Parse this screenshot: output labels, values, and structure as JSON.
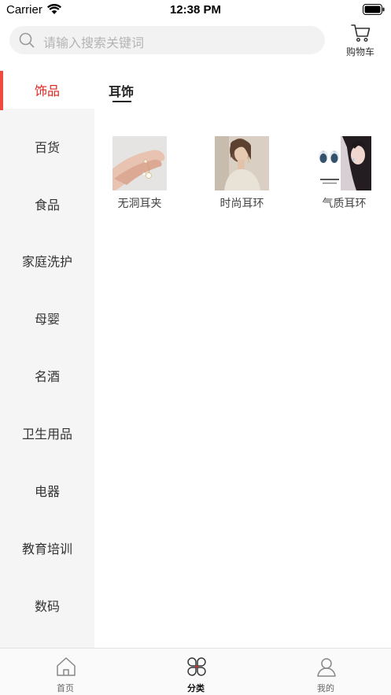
{
  "status": {
    "carrier": "Carrier",
    "time": "12:38 PM"
  },
  "search": {
    "placeholder": "请输入搜索关键词"
  },
  "cart": {
    "label": "购物车"
  },
  "sidebar": {
    "active_index": 0,
    "items": [
      {
        "label": "饰品"
      },
      {
        "label": "百货"
      },
      {
        "label": "食品"
      },
      {
        "label": "家庭洗护"
      },
      {
        "label": "母婴"
      },
      {
        "label": "名酒"
      },
      {
        "label": "卫生用品"
      },
      {
        "label": "电器"
      },
      {
        "label": "教育培训"
      },
      {
        "label": "数码"
      }
    ]
  },
  "content": {
    "subcategory": "耳饰",
    "products": [
      {
        "label": "无洞耳夹"
      },
      {
        "label": "时尚耳环"
      },
      {
        "label": "气质耳环"
      }
    ]
  },
  "tabbar": {
    "items": [
      {
        "label": "首页",
        "icon": "home-icon"
      },
      {
        "label": "分类",
        "icon": "category-icon"
      },
      {
        "label": "我的",
        "icon": "profile-icon"
      }
    ],
    "active_index": 1
  },
  "colors": {
    "accent": "#e0241c",
    "indicator": "#ef4a3e",
    "sidebar_bg": "#f5f5f5"
  }
}
